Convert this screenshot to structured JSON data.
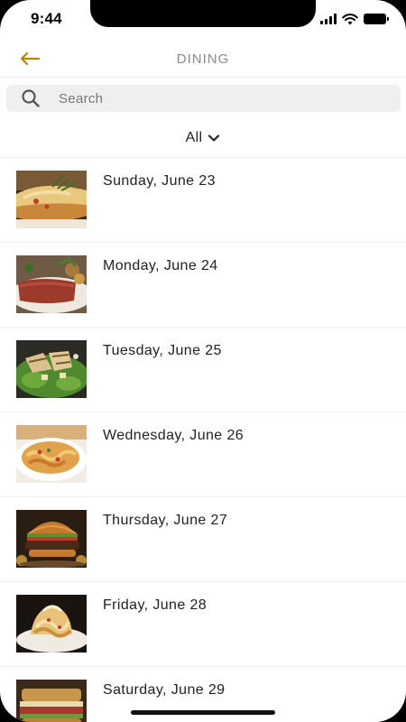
{
  "status_bar": {
    "time": "9:44"
  },
  "header": {
    "title": "DINING",
    "accent_color": "#b8860b"
  },
  "search": {
    "placeholder": "Search"
  },
  "filter": {
    "selected": "All"
  },
  "menu_days": [
    {
      "date": "Sunday, June 23",
      "image": "quiche-photo"
    },
    {
      "date": "Monday, June 24",
      "image": "corned-beef-photo"
    },
    {
      "date": "Tuesday, June 25",
      "image": "chicken-salad-photo"
    },
    {
      "date": "Wednesday, June 26",
      "image": "pasta-photo"
    },
    {
      "date": "Thursday, June 27",
      "image": "burger-photo"
    },
    {
      "date": "Friday, June 28",
      "image": "baked-pasta-photo"
    },
    {
      "date": "Saturday, June 29",
      "image": "sandwich-photo"
    }
  ]
}
